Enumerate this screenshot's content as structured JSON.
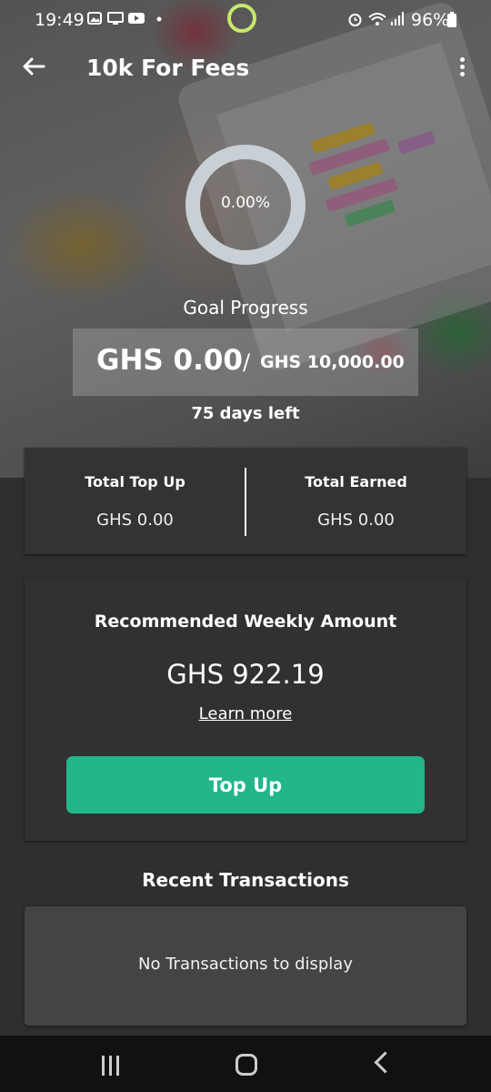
{
  "status_bar": {
    "time": "19:49",
    "battery": "96%",
    "left_icons": [
      "image-icon",
      "screen-cast-icon",
      "youtube-icon",
      "dot-icon"
    ],
    "right_icons": [
      "alarm-icon",
      "wifi-icon",
      "signal-icon",
      "battery-icon"
    ]
  },
  "app_bar": {
    "title": "10k For Fees"
  },
  "goal": {
    "progress_percent": "0.00%",
    "progress_value": 0,
    "label": "Goal Progress",
    "current_amount": "GHS 0.00",
    "separator": "/",
    "target_amount": "GHS 10,000.00",
    "days_left": "75 days left"
  },
  "stats": {
    "total_top_up_label": "Total Top Up",
    "total_top_up_value": "GHS 0.00",
    "total_earned_label": "Total Earned",
    "total_earned_value": "GHS 0.00"
  },
  "weekly": {
    "title": "Recommended Weekly Amount",
    "amount": "GHS 922.19",
    "learn_more": "Learn more",
    "top_up_button": "Top Up"
  },
  "transactions": {
    "title": "Recent Transactions",
    "empty_message": "No Transactions to display"
  },
  "colors": {
    "accent": "#22b68a",
    "ring": "#c8d0d6",
    "background": "#2f2f2f",
    "status_indicator": "#c6e86b"
  }
}
